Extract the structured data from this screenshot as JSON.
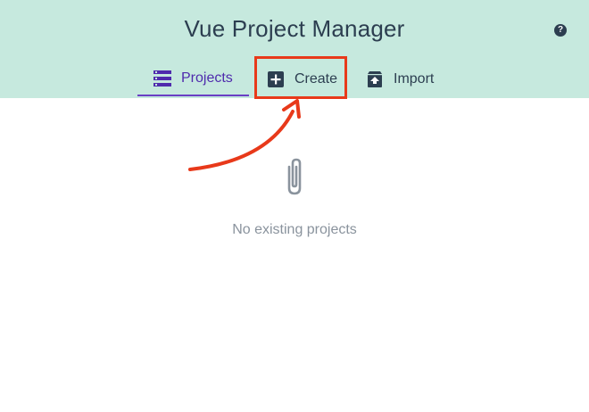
{
  "header": {
    "title": "Vue Project Manager",
    "help_label": "?",
    "background_color": "#c6e9de"
  },
  "tabs": [
    {
      "label": "Projects",
      "icon": "list-icon",
      "active": true
    },
    {
      "label": "Create",
      "icon": "plus-box-icon",
      "active": false
    },
    {
      "label": "Import",
      "icon": "unarchive-icon",
      "active": false
    }
  ],
  "empty_state": {
    "icon": "paperclip-icon",
    "message": "No existing projects"
  },
  "colors": {
    "accent": "#4f2bad",
    "annotation": "#e8391a",
    "text": "#2c3e50"
  }
}
